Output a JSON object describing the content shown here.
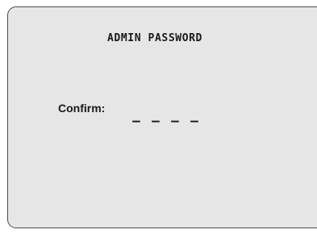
{
  "screen": {
    "title": "ADMIN PASSWORD",
    "confirm_label": "Confirm:",
    "pin_slots": [
      "–",
      "–",
      "–",
      "–"
    ]
  }
}
